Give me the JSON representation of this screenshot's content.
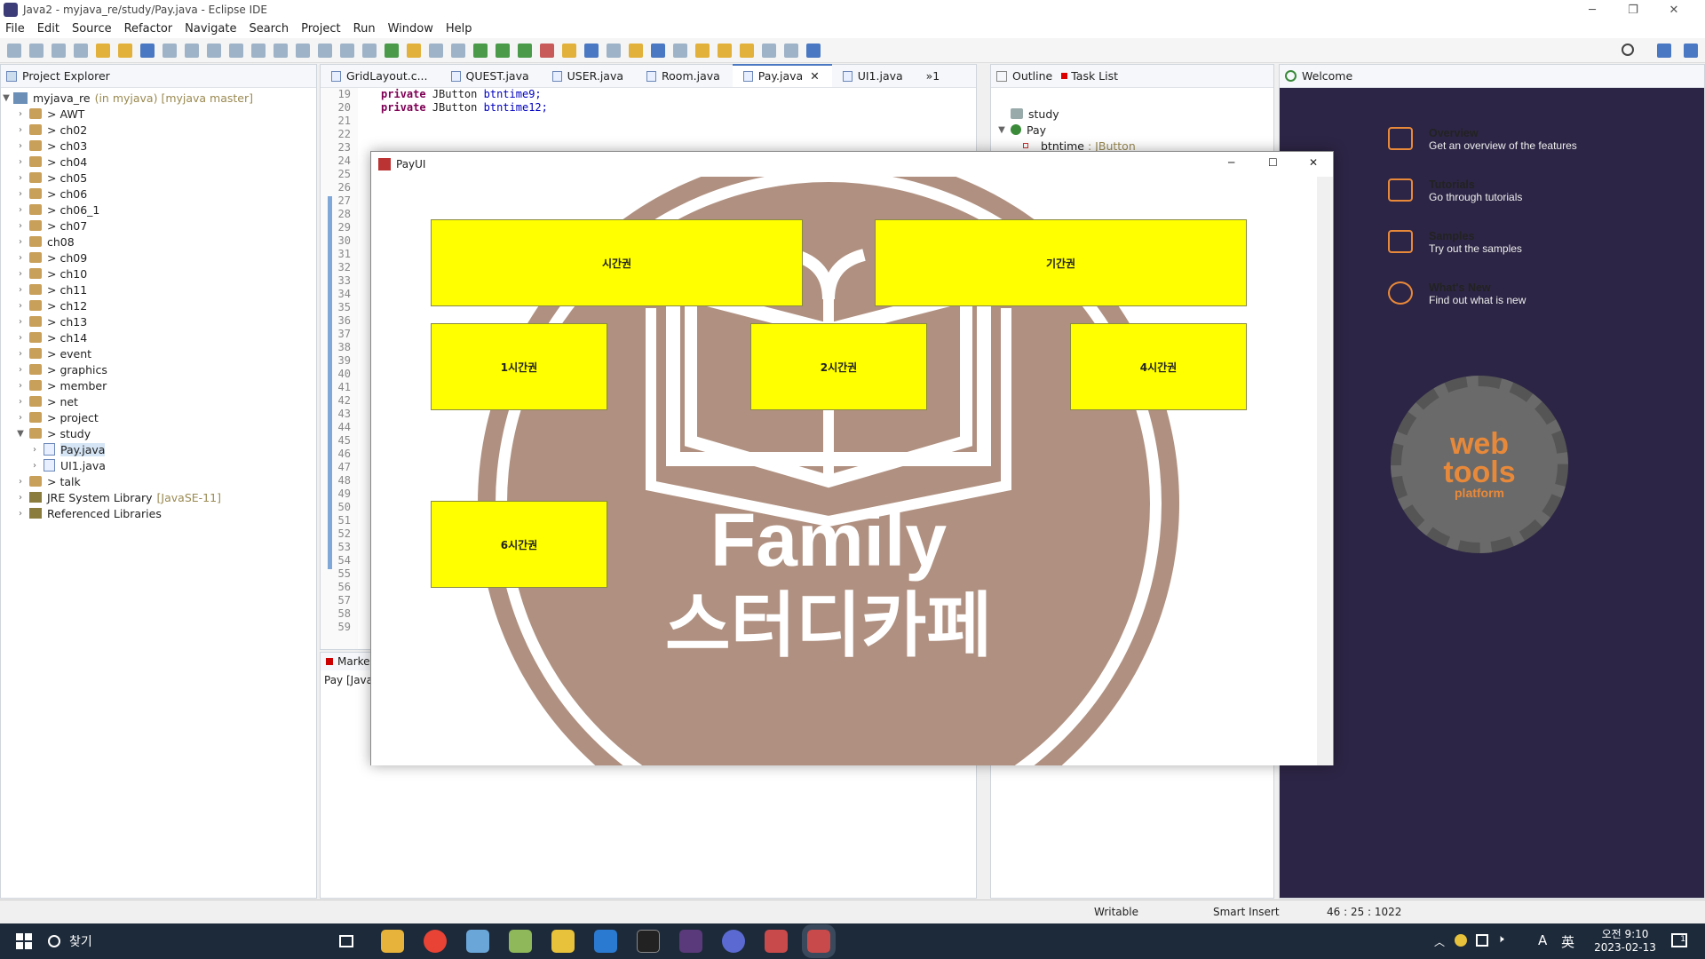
{
  "window": {
    "title": "Java2 - myjava_re/study/Pay.java - Eclipse IDE",
    "minimize": "─",
    "maximize": "❐",
    "close": "✕"
  },
  "menu": [
    "File",
    "Edit",
    "Source",
    "Refactor",
    "Navigate",
    "Search",
    "Project",
    "Run",
    "Window",
    "Help"
  ],
  "project_explorer": {
    "title": "Project Explorer",
    "project": {
      "name": "myjava_re",
      "decoration": "(in myjava) [myjava master]"
    },
    "packages": [
      {
        "label": "> AWT"
      },
      {
        "label": "> ch02"
      },
      {
        "label": "> ch03"
      },
      {
        "label": "> ch04"
      },
      {
        "label": "> ch05"
      },
      {
        "label": "> ch06"
      },
      {
        "label": "> ch06_1"
      },
      {
        "label": "> ch07"
      },
      {
        "label": "ch08"
      },
      {
        "label": "> ch09"
      },
      {
        "label": "> ch10"
      },
      {
        "label": "> ch11"
      },
      {
        "label": "> ch12"
      },
      {
        "label": "> ch13"
      },
      {
        "label": "> ch14"
      },
      {
        "label": "> event"
      },
      {
        "label": "> graphics"
      },
      {
        "label": "> member"
      },
      {
        "label": "> net"
      },
      {
        "label": "> project"
      }
    ],
    "study": {
      "label": "> study",
      "files": [
        "Pay.java",
        "UI1.java"
      ]
    },
    "talk": "> talk",
    "jre": {
      "name": "JRE System Library",
      "version": "[JavaSE-11]"
    },
    "ref_libs": "Referenced Libraries"
  },
  "editor": {
    "tabs": [
      "GridLayout.c...",
      "QUEST.java",
      "USER.java",
      "Room.java",
      "Pay.java",
      "UI1.java",
      "»1"
    ],
    "lines": [
      {
        "n": "19",
        "kw": "private",
        "type": "JButton",
        "field": "btntime9;"
      },
      {
        "n": "20",
        "kw": "private",
        "type": "JButton",
        "field": "btntime12;"
      }
    ],
    "line_numbers": [
      "21",
      "22",
      "23",
      "24",
      "25",
      "26",
      "27",
      "28",
      "29",
      "30",
      "31",
      "32",
      "33",
      "34",
      "35",
      "36",
      "37",
      "38",
      "39",
      "40",
      "41",
      "42",
      "43",
      "44",
      "45",
      "46",
      "47",
      "48",
      "49",
      "50",
      "51",
      "52",
      "53",
      "54",
      "55",
      "56",
      "57",
      "58",
      "59"
    ]
  },
  "markers": {
    "tab": "Markers",
    "row": "Pay [Java A"
  },
  "outline": {
    "tab_outline": "Outline",
    "tab_tasks": "Task List",
    "items": [
      "study",
      "Pay"
    ],
    "member": {
      "name": "btntime",
      "type": ": JButton"
    }
  },
  "welcome": {
    "tab": "Welcome",
    "items": [
      {
        "title": "Overview",
        "desc": "Get an overview of the features"
      },
      {
        "title": "Tutorials",
        "desc": "Go through tutorials"
      },
      {
        "title": "Samples",
        "desc": "Try out the samples"
      },
      {
        "title": "What's New",
        "desc": "Find out what is new"
      }
    ],
    "logo_lines": [
      "web",
      "tools",
      "platform"
    ]
  },
  "status": {
    "mode": "Writable",
    "insert": "Smart Insert",
    "position": "46 : 25 : 1022"
  },
  "dialog": {
    "title": "PayUI",
    "buttons": [
      "시간권",
      "기간권",
      "1시간권",
      "2시간권",
      "4시간권",
      "6시간권"
    ],
    "brand_en": "Family",
    "brand_ko": "스터디카페",
    "logo_color": "#b09080",
    "button_color": "#ffff00"
  },
  "taskbar": {
    "search": "찾기",
    "time": "오전 9:10",
    "date": "2023-02-13",
    "ime": "A",
    "lang": "英",
    "notif": "1"
  }
}
